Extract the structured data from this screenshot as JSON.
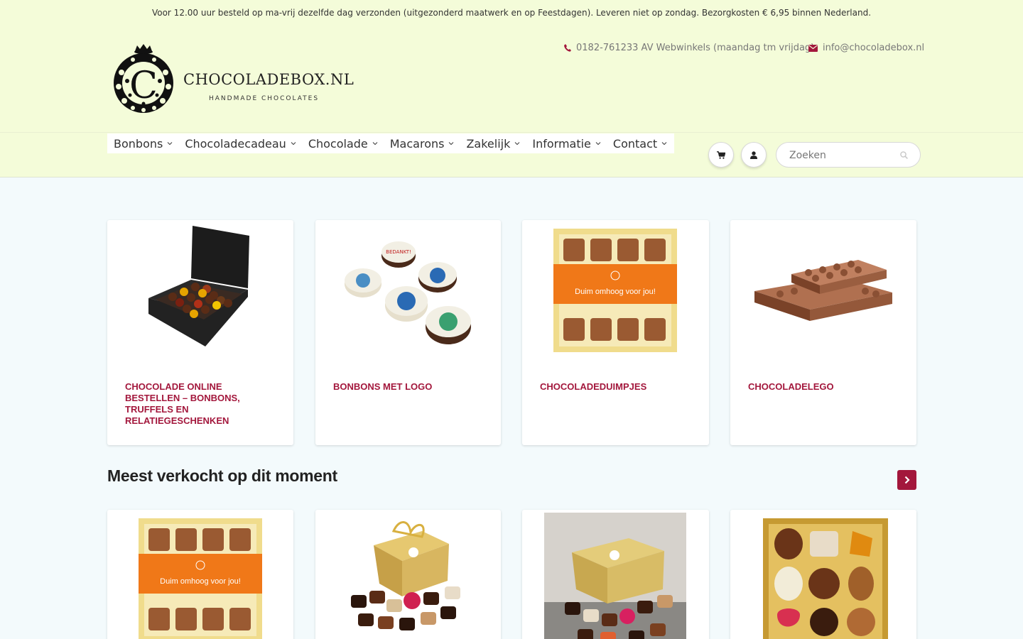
{
  "topbar": {
    "notice": "Voor 12.00 uur besteld op ma-vrij dezelfde dag verzonden (uitgezonderd maatwerk en op Feestdagen). Leveren niet op zondag. Bezorgkosten € 6,95 binnen Nederland."
  },
  "header": {
    "logo_letter": "C",
    "logo_name": "CHOCOLADEBOX.NL",
    "logo_tagline": "HANDMADE CHOCOLATES",
    "phone": "0182-761233 AV Webwinkels (maandag tm vrijdag)",
    "email": "info@chocoladebox.nl"
  },
  "nav": {
    "items": [
      {
        "label": "Bonbons"
      },
      {
        "label": "Chocoladecadeau"
      },
      {
        "label": "Chocolade"
      },
      {
        "label": "Macarons"
      },
      {
        "label": "Zakelijk"
      },
      {
        "label": "Informatie"
      },
      {
        "label": "Contact"
      }
    ]
  },
  "search": {
    "placeholder": "Zoeken"
  },
  "categories": [
    {
      "title": "Chocolade online bestellen – bonbons, truffels en relatiegeschenken"
    },
    {
      "title": "Bonbons met logo",
      "badge_text": "BEDANKT!"
    },
    {
      "title": "Chocoladeduimpjes",
      "band_text": "Duim omhoog voor jou!"
    },
    {
      "title": "Chocoladelego"
    }
  ],
  "bestsellers": {
    "title": "Meest verkocht op dit moment",
    "first_band_text": "Duim omhoog voor jou!"
  },
  "colors": {
    "accent": "#a3173c",
    "header_bg": "#f4fcd9",
    "page_bg": "#f3fafc"
  }
}
